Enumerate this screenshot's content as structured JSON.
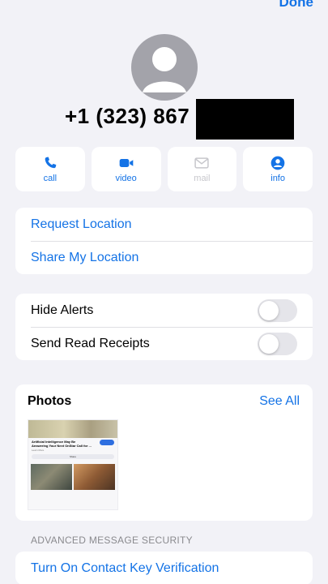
{
  "header": {
    "done_label": "Done"
  },
  "contact": {
    "phone_number": "+1 (323) 867"
  },
  "actions": [
    {
      "label": "call",
      "icon": "phone-icon",
      "enabled": true
    },
    {
      "label": "video",
      "icon": "video-icon",
      "enabled": true
    },
    {
      "label": "mail",
      "icon": "mail-icon",
      "enabled": false
    },
    {
      "label": "info",
      "icon": "person-icon",
      "enabled": true
    }
  ],
  "location": {
    "request_label": "Request Location",
    "share_label": "Share My Location"
  },
  "settings": {
    "hide_alerts_label": "Hide Alerts",
    "hide_alerts_on": false,
    "read_receipts_label": "Send Read Receipts",
    "read_receipts_on": false
  },
  "photos": {
    "title": "Photos",
    "see_all_label": "See All",
    "thumbnail": {
      "headline": "Artificial Intelligence May Be Answering Your Next OnStar Call for ...",
      "subtext": "Learn More",
      "button": "Share"
    }
  },
  "security": {
    "section_label": "ADVANCED MESSAGE SECURITY",
    "key_verification_label": "Turn On Contact Key Verification"
  },
  "colors": {
    "accent": "#1473e6",
    "background": "#f2f2f7",
    "disabled": "#c7c7cc"
  }
}
